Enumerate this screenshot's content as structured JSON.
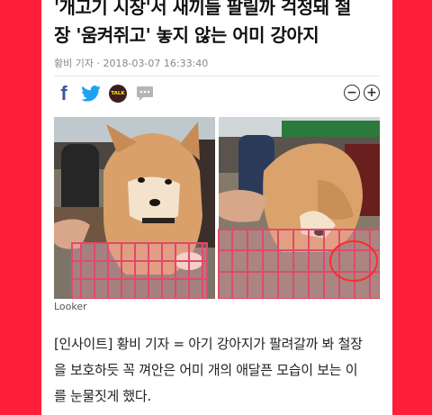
{
  "article": {
    "headline_line1": "'개고기 시장'서 새끼들 팔릴까 걱정돼 철",
    "headline_line2": "장 '움켜쥐고' 놓지 않는 어미 강아지",
    "byline": "황비 기자 · 2018-03-07 16:33:40",
    "share": {
      "facebook": "f",
      "kakao_talk": "TALK"
    },
    "font_controls": {
      "decrease": "−",
      "increase": "+"
    },
    "photo_credit": "Looker",
    "body_line1": "[인사이트] 황비 기자 = 아기 강아지가 팔려갈까 봐 철장",
    "body_line2": "을 보호하듯 꼭 껴안은 어미 개의 애달픈 모습이 보는 이",
    "body_line3": "를 눈물짓게 했다."
  },
  "colors": {
    "frame": "#ff1f3a",
    "facebook": "#3b5998",
    "twitter": "#1da1f2",
    "kakao": "#3c1e1e"
  },
  "icons": [
    "facebook-icon",
    "twitter-icon",
    "kakaotalk-icon",
    "speech-bubble-icon",
    "zoom-out-icon",
    "zoom-in-icon"
  ]
}
